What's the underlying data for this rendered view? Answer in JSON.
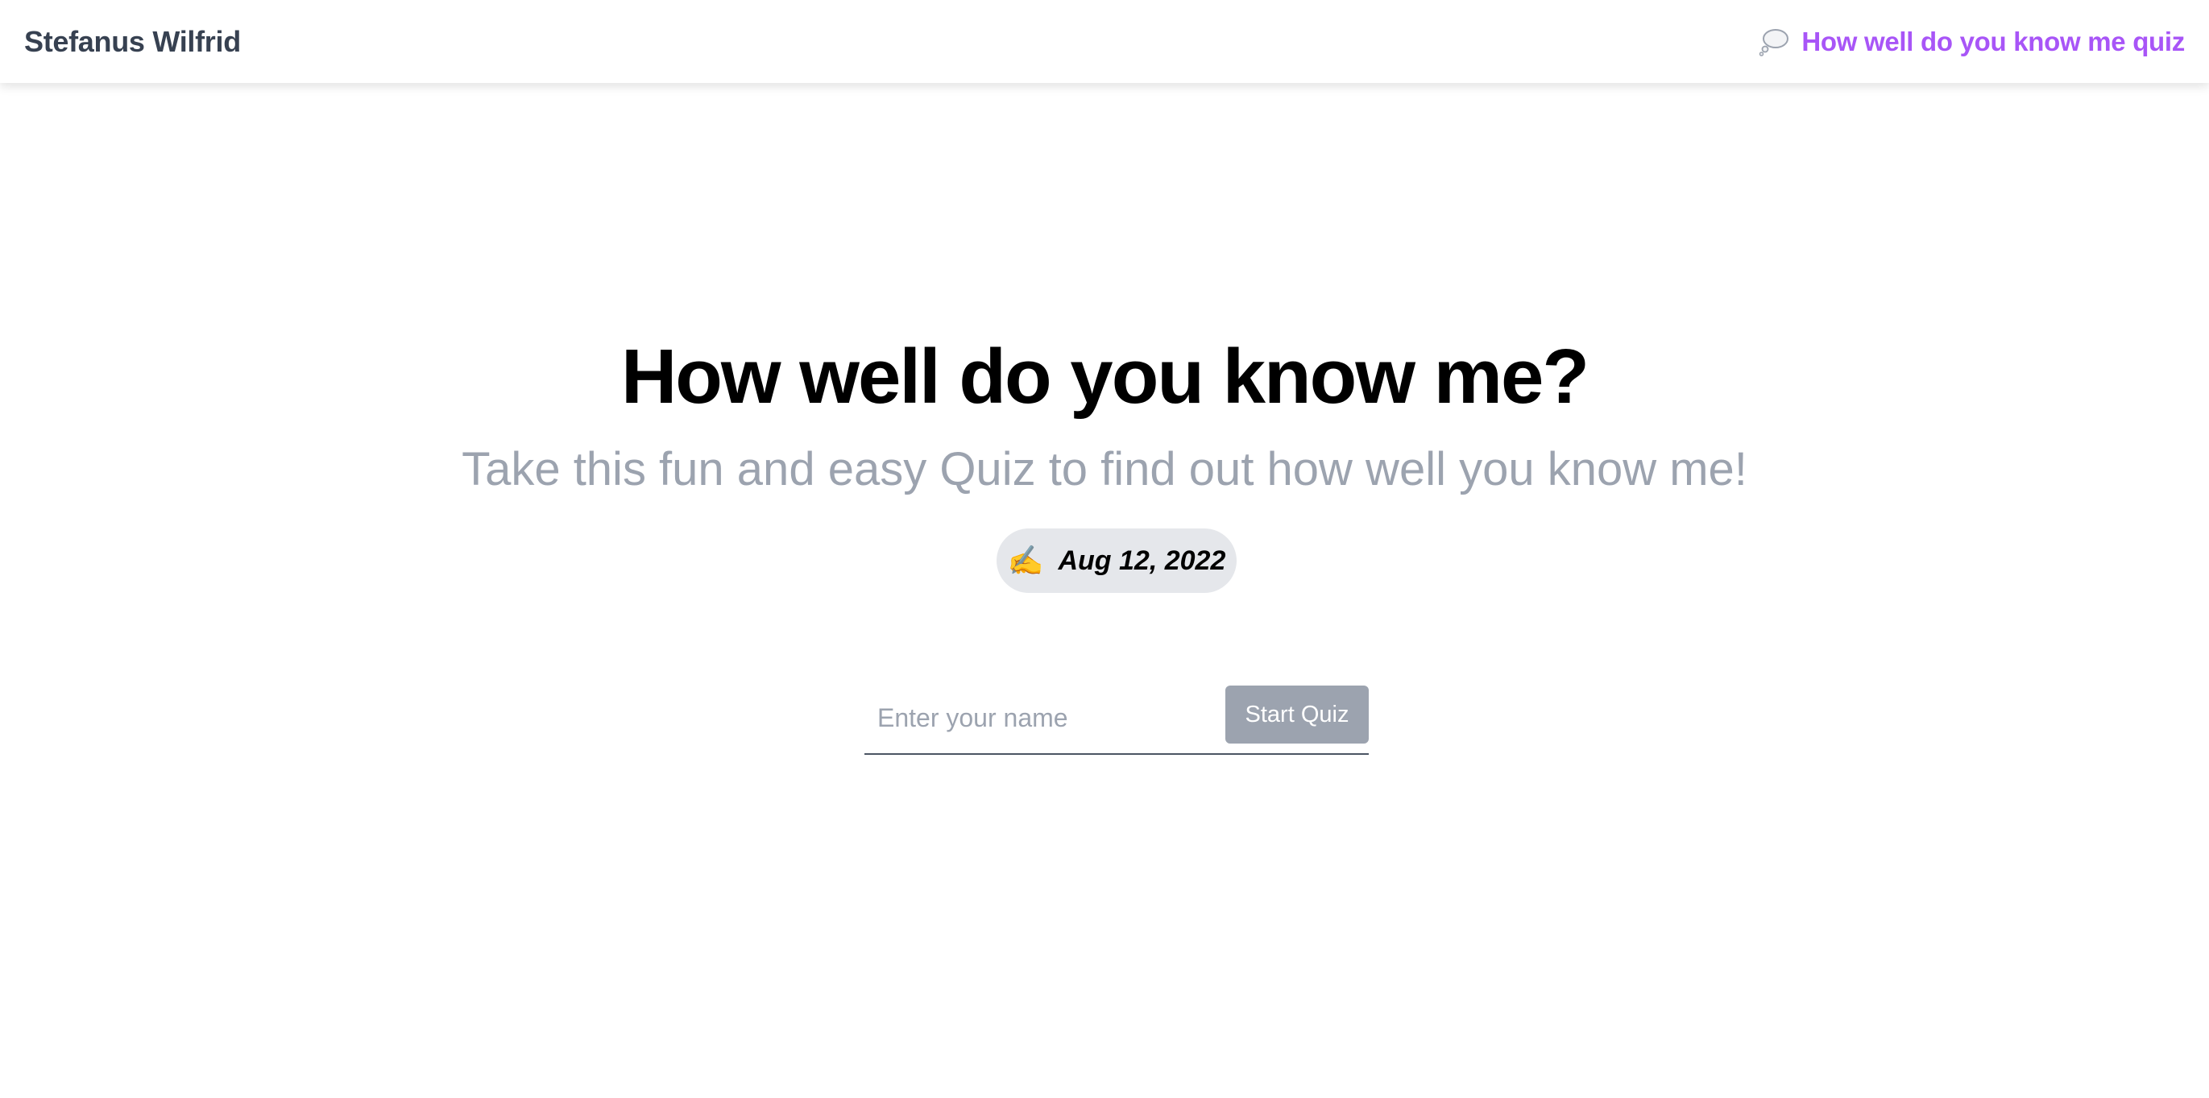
{
  "navbar": {
    "brand": "Stefanus Wilfrid",
    "link_icon": "thought-balloon-icon",
    "link_label": "How well do you know me quiz"
  },
  "hero": {
    "title": "How well do you know me?",
    "subtitle": "Take this fun and easy Quiz to find out how well you know me!",
    "date_icon": "writing-hand-icon",
    "date": "Aug 12, 2022"
  },
  "form": {
    "name_placeholder": "Enter your name",
    "name_value": "",
    "start_label": "Start Quiz"
  },
  "colors": {
    "accent": "#a855f7",
    "brand_text": "#374151",
    "muted_text": "#9ca3af",
    "badge_bg": "#e5e7eb",
    "button_bg": "#9ca3af"
  }
}
